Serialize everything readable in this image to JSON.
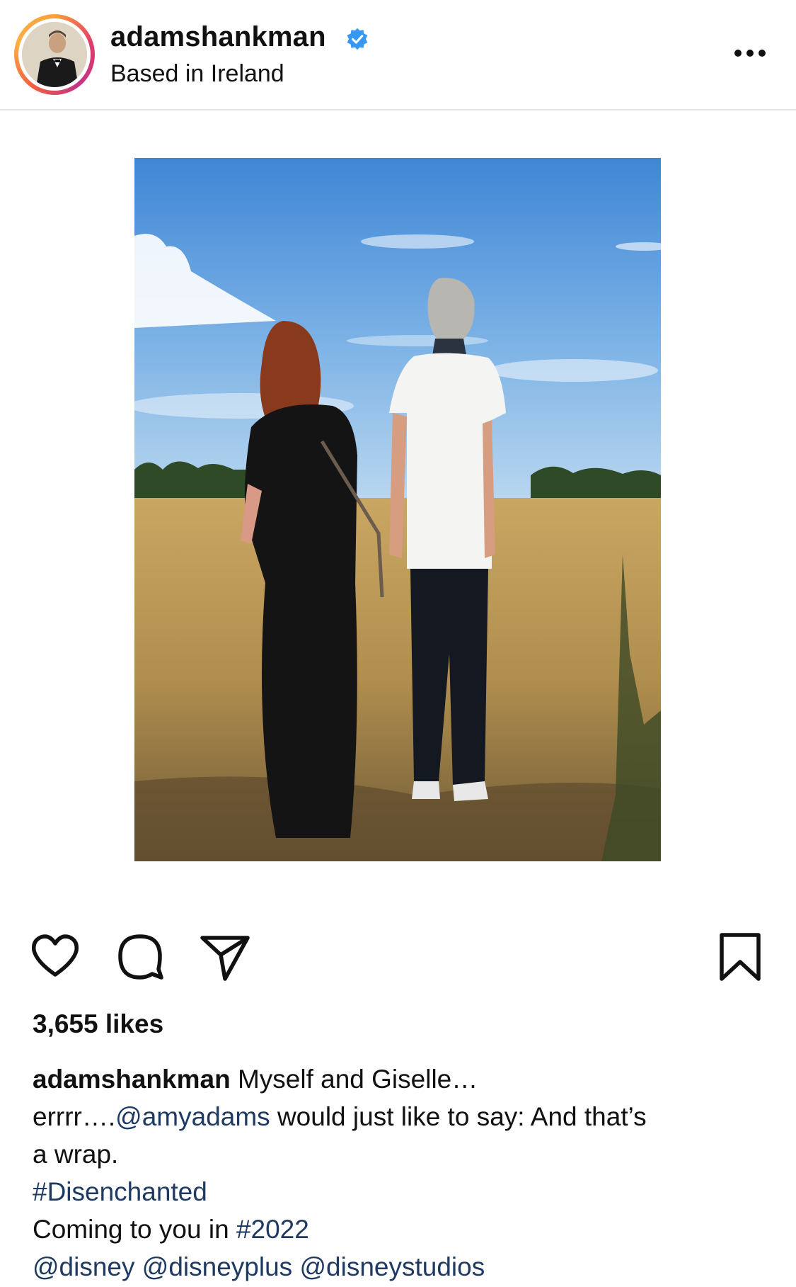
{
  "header": {
    "username": "adamshankman",
    "location": "Based in Ireland",
    "verified": true,
    "more_icon": "more-horizontal-icon"
  },
  "post": {
    "image_icon": "photo"
  },
  "actions": {
    "like_icon": "heart-icon",
    "comment_icon": "comment-bubble-icon",
    "share_icon": "send-icon",
    "save_icon": "bookmark-icon"
  },
  "likes": "3,655 likes",
  "caption": {
    "username": "adamshankman",
    "line1_text": " Myself and Giselle…",
    "line2_prefix": "errrr….",
    "mention_amy": "@amyadams",
    "line2_suffix": " would just like to say: And that’s",
    "line3": "a wrap.",
    "hashtag_disenchanted": "#Disenchanted",
    "line5_prefix": "Coming to you in ",
    "hashtag_2022": "#2022",
    "mention_disney": "@disney",
    "mention_disneyplus": "@disneyplus",
    "mention_disneystudios": "@disneystudios"
  },
  "colors": {
    "link": "#1e3a63",
    "verified": "#3897f0",
    "text": "#111111"
  }
}
